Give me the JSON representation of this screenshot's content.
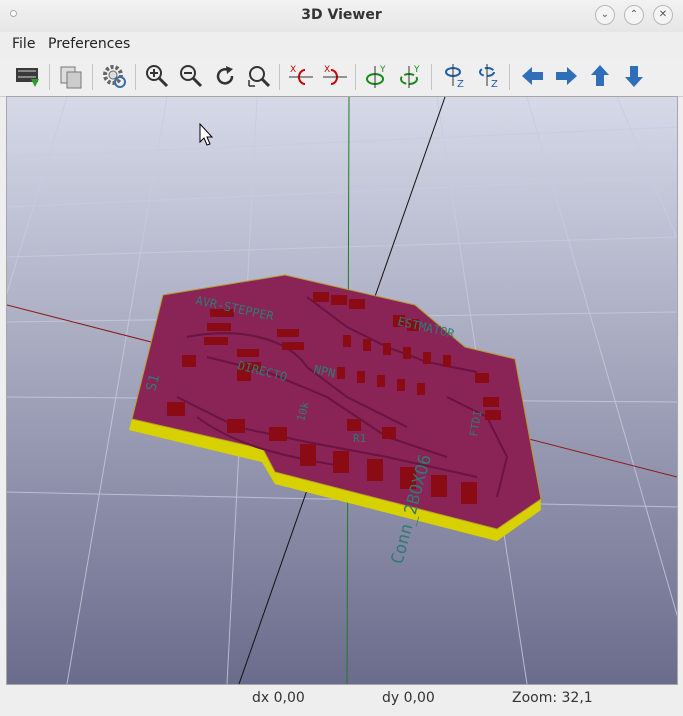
{
  "window": {
    "title": "3D Viewer"
  },
  "menu": {
    "file": "File",
    "preferences": "Preferences"
  },
  "toolbar": {
    "buttons": [
      {
        "name": "reload-board-icon"
      },
      {
        "name": "copy-to-clipboard-icon"
      },
      {
        "name": "settings-icon"
      },
      {
        "name": "zoom-in-icon"
      },
      {
        "name": "zoom-out-icon"
      },
      {
        "name": "redraw-icon"
      },
      {
        "name": "zoom-auto-icon"
      },
      {
        "name": "rotate-x-cw-icon"
      },
      {
        "name": "rotate-x-ccw-icon"
      },
      {
        "name": "rotate-y-cw-icon"
      },
      {
        "name": "rotate-y-ccw-icon"
      },
      {
        "name": "rotate-z-cw-icon"
      },
      {
        "name": "rotate-z-ccw-icon"
      },
      {
        "name": "move-left-icon"
      },
      {
        "name": "move-right-icon"
      },
      {
        "name": "move-up-icon"
      },
      {
        "name": "move-down-icon"
      }
    ]
  },
  "board_labels": {
    "l1": "AVR-STEPPER",
    "l2": "ESTMATOR",
    "l3": "NPN",
    "l4": "DIRECTO",
    "l5": "S1",
    "l6": "10k",
    "l7": "R1",
    "l8": "Conn_2BOXO6",
    "l9": "FTDI"
  },
  "status": {
    "dx": "dx 0,00",
    "dy": "dy 0,00",
    "zoom": "Zoom: 32,1"
  },
  "colors": {
    "board_top": "#8a2356",
    "board_edge": "#cfc800",
    "pad": "#8a0b14",
    "silk": "#2f7a74",
    "x_axis": "#8a1a1a",
    "y_axis": "#1f7a1f",
    "z_axis": "#111111"
  }
}
